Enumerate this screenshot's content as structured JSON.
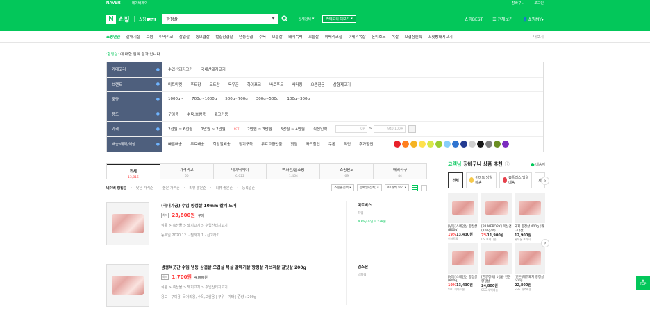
{
  "topbar": {
    "naver": "NAVER",
    "left_link": "네이버페이",
    "right": [
      "장바구니",
      "로그인"
    ]
  },
  "header": {
    "logo": "N",
    "logo_text": "쇼핑",
    "live_text": "쇼핑",
    "live_badge": "LIVE",
    "search_value": "항정살",
    "detail_search": "상세검색",
    "category_more": "카테고리 더보기",
    "right": [
      "쇼핑BEST",
      "전체보기",
      "쇼핑MY"
    ]
  },
  "catnav": {
    "items": [
      "쇼핑연관",
      "갈매기살",
      "보쌈",
      "이베리코",
      "삼겹살",
      "통오겹살",
      "벌집삼겹살",
      "냉동삼겹",
      "수육",
      "오겹살",
      "돼지목뼈",
      "꼬들살",
      "이베리코살",
      "이베리목살",
      "돈마호크",
      "목살",
      "오겹삼원특",
      "꼬릿빵돼지고기"
    ],
    "more": "더보기"
  },
  "result_msg": {
    "query": "'항정살'",
    "text": " 에 대한 검색 결과 입니다."
  },
  "filters": [
    {
      "label": "카테고리",
      "values": [
        "수입산돼지고기",
        "국내산돼지고기"
      ]
    },
    {
      "label": "브랜드",
      "values": [
        "미트마켓",
        "푸드장",
        "도드람",
        "육우촌",
        "하이포크",
        "바로푸드",
        "배터킹",
        "으뜸한돈",
        "삼형제고기"
      ]
    },
    {
      "label": "중량",
      "values": [
        "1000g~",
        "700g~1000g",
        "500g~700g",
        "300g~500g",
        "100g~300g"
      ]
    },
    {
      "label": "용도",
      "values": [
        "구이용",
        "수육,보쌈용",
        "불고기용"
      ]
    },
    {
      "label": "가격",
      "values": [
        "2천원 ~ 6천원",
        "1만원 ~ 2만원",
        "2만원 ~ 3만원",
        "3만원 ~ 4만원",
        "직접입력"
      ],
      "price_min": "0원",
      "price_max": "940,100원",
      "hot": "HOT"
    },
    {
      "label": "배송/혜택/색상",
      "values": [
        "빠른배송",
        "무료배송",
        "희망일배송",
        "정기구독",
        "무료교환반품",
        "핫딜",
        "카드할인",
        "쿠폰",
        "적립",
        "추가할인"
      ]
    }
  ],
  "colors": [
    "#e8212a",
    "#ff7f1e",
    "#f5b323",
    "#ffe14d",
    "#d8e84a",
    "#9acd32",
    "#87cefa",
    "#2f74d0",
    "#233b91",
    "#cfcfcf",
    "#181818",
    "#808080",
    "#6b8e23",
    "#7b2cbf"
  ],
  "tabs": [
    {
      "label": "전체",
      "count": "13,816"
    },
    {
      "label": "가격비교",
      "count": "60"
    },
    {
      "label": "네이버페이",
      "count": "6,022"
    },
    {
      "label": "백화점/홈쇼핑",
      "count": "1,464"
    },
    {
      "label": "쇼핑윈도",
      "count": "69"
    },
    {
      "label": "해외직구",
      "count": "44"
    }
  ],
  "sortbar": {
    "items": [
      "네이버 랭킹순",
      "낮은 가격순",
      "높은 가격순",
      "리뷰 많은순",
      "리뷰 좋은순",
      "등록일순"
    ],
    "sel1": "쇼핑몰선택",
    "sel2": "등록일(전체)",
    "sel3": "40개씩 보기"
  },
  "items": [
    {
      "title": "(국내가공) 수입 항정살 10mm 칼레 도매",
      "lowest": "최저",
      "price": "23,800원",
      "extra": "구매",
      "category": "식품 > 축산물 > 돼지고기 > 수입산돼지고기",
      "meta": "등록일 2020.12.  ·  찜하기 1  ·  신고하기",
      "mall": "미트박스",
      "mall_sub": "파워",
      "mall_np": "N Pay 포인트 238원"
    },
    {
      "title": "생생육곳간 수입 냉동 삼겹살 오겹살 목살 갈매기살 항정살 가브리살 갈빗살 200g",
      "lowest": "최저",
      "price": "1,700원",
      "extra": "4,000원",
      "category": "식품 > 축산물 > 돼지고기 > 수입산돼지고기",
      "meta": "용도 : 구이용, 국거리용, 수육,보쌈용  |  부위 : 기타  |  중량 : 200g",
      "mall": "엠스몬",
      "mall_sub": "빅파워",
      "mall_np": ""
    }
  ],
  "side": {
    "title_g": "고객님",
    "title": " 장바구니 상품 추천",
    "region": "배송지",
    "tabs": [
      "전체",
      "이마트 당일배송",
      "홈플러스 당일배송",
      "세"
    ],
    "cards": [
      {
        "name": "[냉동]스페인산 항정살 (800g)",
        "disc": "19%",
        "price": "13,430원",
        "mall": "이마트몰"
      },
      {
        "name": "[PRIMEPORK] 목삼겹 (700g/팩)",
        "disc": "7%",
        "price": "11,900원",
        "mall": "GS 프레시몰"
      },
      {
        "name": "돼지 항정살 400g (캐나다산)",
        "disc": "",
        "price": "12,900원",
        "mall": "롯데온 프레시"
      },
      {
        "name": "[냉동]스페인산 항정살 (800g)",
        "disc": "19%",
        "price": "13,430원",
        "mall": "SSG 이마트몰"
      },
      {
        "name": "[한양정육] 1등급 한돈 항정살",
        "disc": "",
        "price": "24,800원",
        "mall": "SSG 새벽배송"
      },
      {
        "name": "[한돈]제주돼지 항정살 500g",
        "disc": "",
        "price": "22,800원",
        "mall": "SSG 새벽배송"
      }
    ]
  },
  "top_btn": "TOP"
}
